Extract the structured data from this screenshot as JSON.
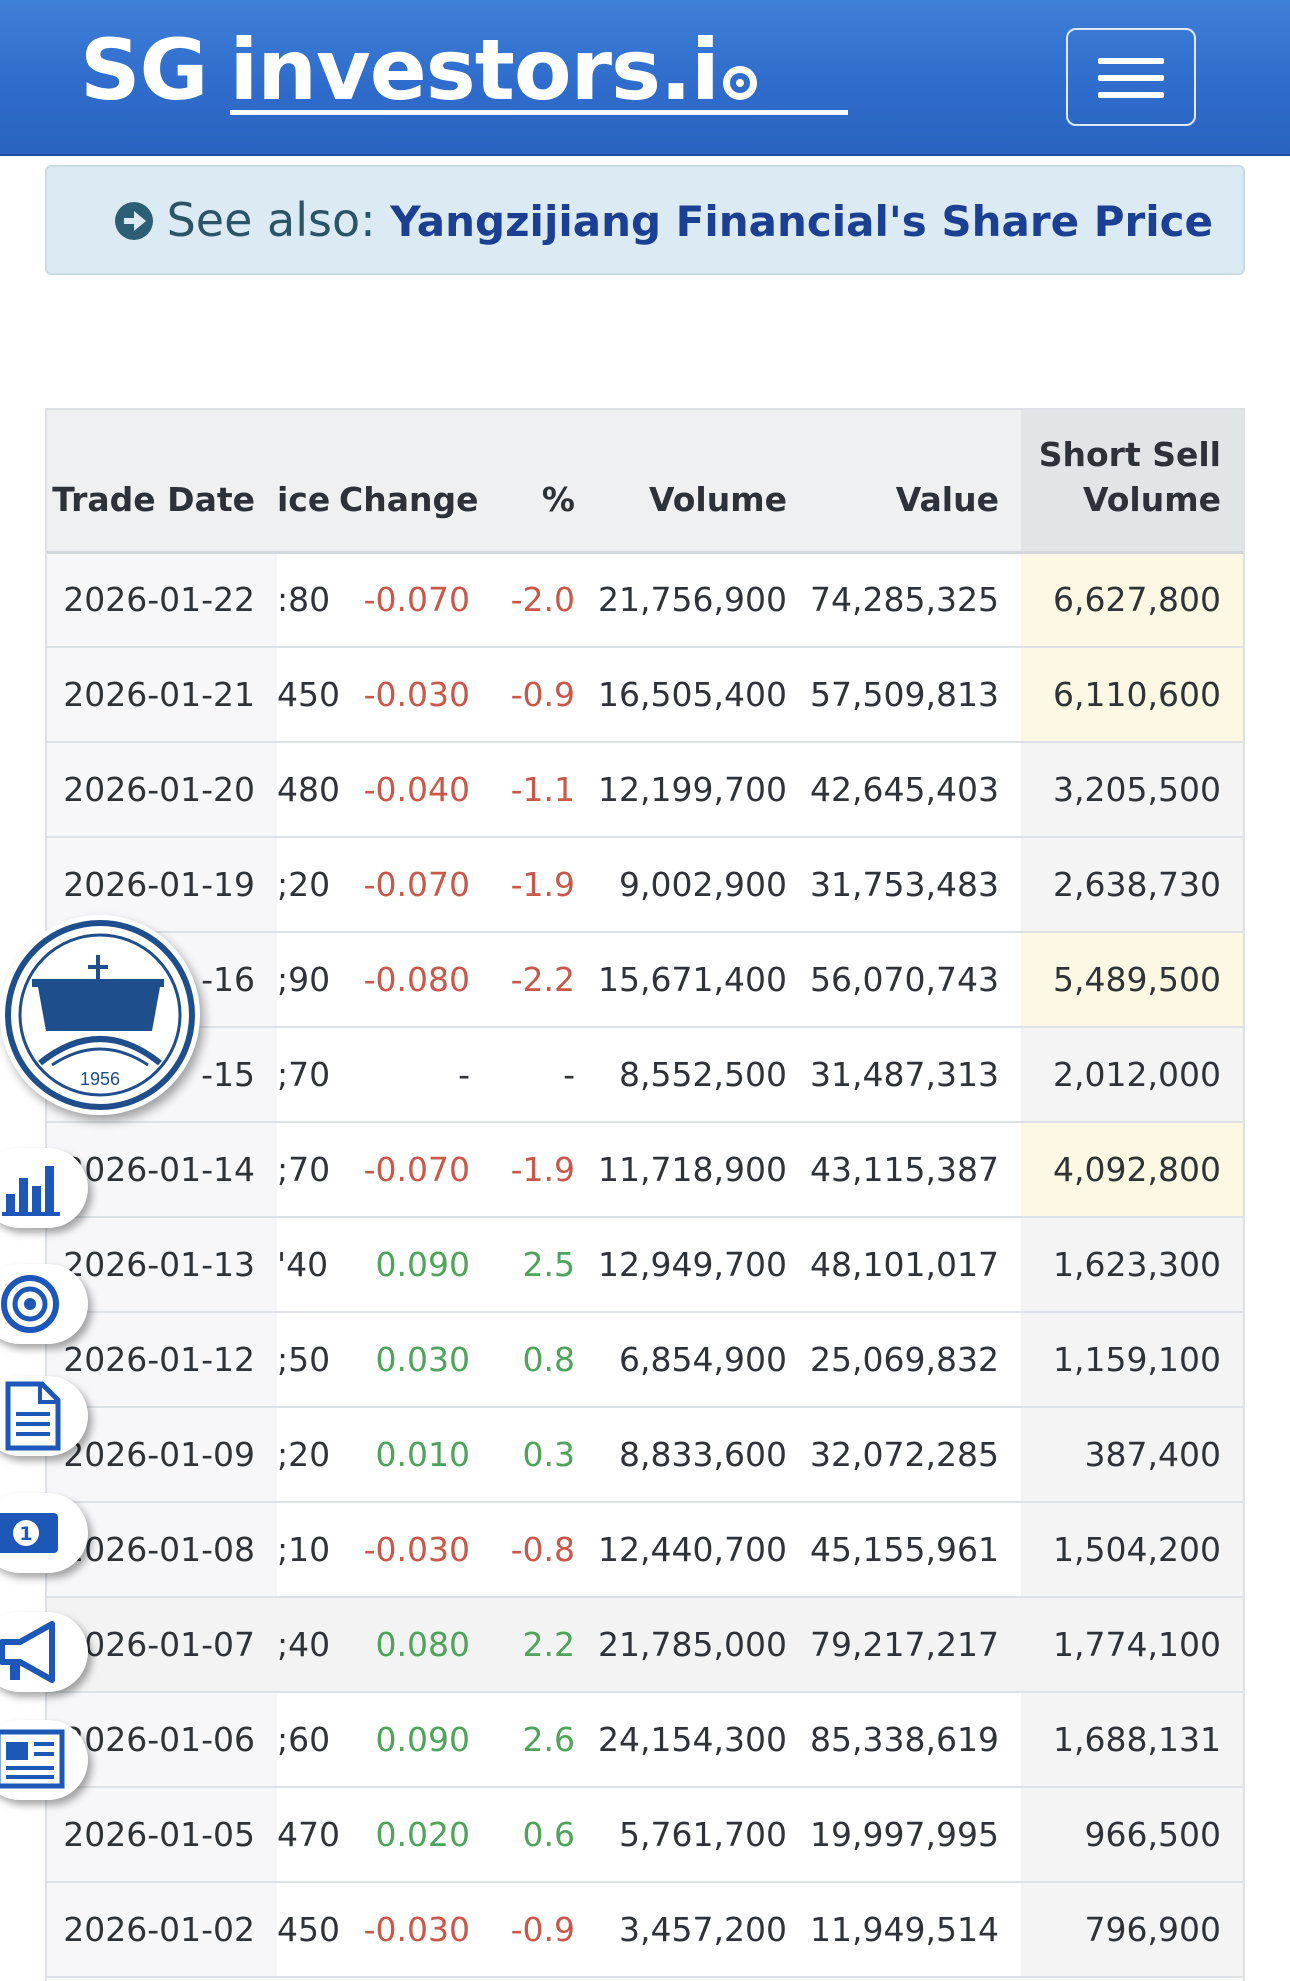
{
  "header": {
    "logo_sg": "SG",
    "logo_investors": "investors.i",
    "menu_icon": "hamburger-icon",
    "brand_color": "#2f6ccc"
  },
  "see_also": {
    "icon": "arrow-circle-right-icon",
    "label": "See also:",
    "link": "Yangzijiang Financial's Share Price"
  },
  "table": {
    "columns": [
      "Trade Date",
      "ice",
      "Change",
      "%",
      "Volume",
      "Value",
      "Short Sell",
      "Volume"
    ],
    "rows": [
      {
        "date": "2026-01-22",
        "price": ":80",
        "change": "-0.070",
        "pct": "-2.0",
        "volume": "21,756,900",
        "value": "74,285,325",
        "short": "6,627,800",
        "dir": "neg",
        "hl": true
      },
      {
        "date": "2026-01-21",
        "price": "450",
        "change": "-0.030",
        "pct": "-0.9",
        "volume": "16,505,400",
        "value": "57,509,813",
        "short": "6,110,600",
        "dir": "neg",
        "hl": true
      },
      {
        "date": "2026-01-20",
        "price": "480",
        "change": "-0.040",
        "pct": "-1.1",
        "volume": "12,199,700",
        "value": "42,645,403",
        "short": "3,205,500",
        "dir": "neg",
        "hl": false
      },
      {
        "date": "2026-01-19",
        "price": ";20",
        "change": "-0.070",
        "pct": "-1.9",
        "volume": "9,002,900",
        "value": "31,753,483",
        "short": "2,638,730",
        "dir": "neg",
        "hl": false
      },
      {
        "date": "-16",
        "price": ";90",
        "change": "-0.080",
        "pct": "-2.2",
        "volume": "15,671,400",
        "value": "56,070,743",
        "short": "5,489,500",
        "dir": "neg",
        "hl": true
      },
      {
        "date": "-15",
        "price": ";70",
        "change": "-",
        "pct": "-",
        "volume": "8,552,500",
        "value": "31,487,313",
        "short": "2,012,000",
        "dir": "flat",
        "hl": false
      },
      {
        "date": "2026-01-14",
        "price": ";70",
        "change": "-0.070",
        "pct": "-1.9",
        "volume": "11,718,900",
        "value": "43,115,387",
        "short": "4,092,800",
        "dir": "neg",
        "hl": true
      },
      {
        "date": "2026-01-13",
        "price": "'40",
        "change": "0.090",
        "pct": "2.5",
        "volume": "12,949,700",
        "value": "48,101,017",
        "short": "1,623,300",
        "dir": "pos",
        "hl": false
      },
      {
        "date": "2026-01-12",
        "price": ";50",
        "change": "0.030",
        "pct": "0.8",
        "volume": "6,854,900",
        "value": "25,069,832",
        "short": "1,159,100",
        "dir": "pos",
        "hl": false
      },
      {
        "date": "2026-01-09",
        "price": ";20",
        "change": "0.010",
        "pct": "0.3",
        "volume": "8,833,600",
        "value": "32,072,285",
        "short": "387,400",
        "dir": "pos",
        "hl": false
      },
      {
        "date": "2026-01-08",
        "price": ";10",
        "change": "-0.030",
        "pct": "-0.8",
        "volume": "12,440,700",
        "value": "45,155,961",
        "short": "1,504,200",
        "dir": "neg",
        "hl": false
      },
      {
        "date": "2026-01-07",
        "price": ";40",
        "change": "0.080",
        "pct": "2.2",
        "volume": "21,785,000",
        "value": "79,217,217",
        "short": "1,774,100",
        "dir": "pos",
        "hl": false,
        "alt": true
      },
      {
        "date": "2026-01-06",
        "price": ";60",
        "change": "0.090",
        "pct": "2.6",
        "volume": "24,154,300",
        "value": "85,338,619",
        "short": "1,688,131",
        "dir": "pos",
        "hl": false
      },
      {
        "date": "2026-01-05",
        "price": "470",
        "change": "0.020",
        "pct": "0.6",
        "volume": "5,761,700",
        "value": "19,997,995",
        "short": "966,500",
        "dir": "pos",
        "hl": false
      },
      {
        "date": "2026-01-02",
        "price": "450",
        "change": "-0.030",
        "pct": "-0.9",
        "volume": "3,457,200",
        "value": "11,949,514",
        "short": "796,900",
        "dir": "neg",
        "hl": false
      }
    ]
  },
  "side": {
    "logo_year": "1956",
    "buttons": [
      "bar-chart-icon",
      "target-icon",
      "document-icon",
      "money-icon",
      "megaphone-icon",
      "newspaper-icon"
    ]
  },
  "colors": {
    "negative": "#c9584a",
    "positive": "#4fa35a",
    "highlight": "#fcf8e3",
    "icon_blue": "#1d57b8"
  }
}
